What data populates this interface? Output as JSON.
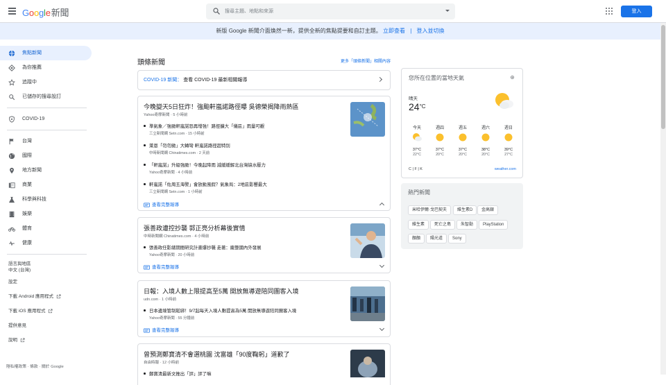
{
  "header": {
    "logo_parts": [
      "G",
      "o",
      "o",
      "g",
      "l",
      "e"
    ],
    "logo_suffix": "新聞",
    "search_placeholder": "搜尋主題、地點和來源",
    "signin_label": "登入"
  },
  "banner": {
    "text": "新版 Google 新聞介面煥然一新，提供全新的焦點提要和自訂主題。",
    "try_link": "立即查看",
    "separator": "|",
    "login_link": "登入並切換"
  },
  "sidebar": {
    "items": [
      {
        "label": "焦點新聞",
        "icon": "globe-icon",
        "active": true
      },
      {
        "label": "為你推薦",
        "icon": "diamond-icon"
      },
      {
        "label": "追蹤中",
        "icon": "star-icon"
      },
      {
        "label": "已儲存的搜尋設訂",
        "icon": "search-icon"
      }
    ],
    "covid": {
      "label": "COVID-19",
      "icon": "shield-icon"
    },
    "sections": [
      {
        "label": "台灣",
        "icon": "flag-icon"
      },
      {
        "label": "國際",
        "icon": "globe-icon"
      },
      {
        "label": "地方新聞",
        "icon": "pin-icon"
      },
      {
        "label": "商業",
        "icon": "building-icon"
      },
      {
        "label": "科學與科技",
        "icon": "flask-icon"
      },
      {
        "label": "娛樂",
        "icon": "film-icon"
      },
      {
        "label": "體育",
        "icon": "bike-icon"
      },
      {
        "label": "健康",
        "icon": "health-icon"
      }
    ],
    "lang_title": "語言與地區",
    "lang_value": "中文 (台灣)",
    "settings": "設定",
    "android": "下載 Android 應用程式",
    "ios": "下載 iOS 應用程式",
    "feedback": "提供意見",
    "help": "說明"
  },
  "footer": "隱私權政策 · 條款 · 關於 Google",
  "main": {
    "title": "頭條新聞",
    "more": "更多「頭條新聞」相關內容",
    "covid_label": "COVID-19 新聞：",
    "covid_text": "查看 COVID-19 最新相關報導",
    "full_coverage": "查看完整報導",
    "stories": [
      {
        "title": "今晚變天5日狂炸！強颱軒嵐諾路徑曝 吳德榮揭降雨熱區",
        "source": "Yahoo奇摩新聞 · 5 小時前",
        "subs": [
          {
            "title": "準氣象／強颱軒嵐諾恐再增強！路徑擴大「儀區」雨量可觀",
            "source": "三立新聞網 Setn.com · 15 小時前"
          },
          {
            "title": "萊恩「勿勿颱」大轉彎 軒嵐諾路徑超特別",
            "source": "中時新聞網 Chinatimes.com · 2 天前"
          },
          {
            "title": "「軒嵐諾」升級強颱！今晚起降雨 減緩緩解北台灣缺水壓力",
            "source": "Yahoo奇摩新聞 · 4 小時前"
          },
          {
            "title": "軒嵐諾「佐周五海警」會放颱風假？氣象局：2地區影響最大",
            "source": "三立新聞網 Setn.com · 1 小時前"
          }
        ]
      },
      {
        "title": "張善政遭控抄襲 郭正亮分析幕後實情",
        "source": "中時新聞網 Chinatimes.com · 4 小時前",
        "subs": [
          {
            "title": "張善政任影總期間研究計畫爆抄襲 走著：龐整國內外發展",
            "source": "Yahoo奇摩新聞 · 20 小時前"
          }
        ]
      },
      {
        "title": "日報：入境人數上限提高至5萬 開放無導遊陪同團客入境",
        "source": "udn.com · 1 小時前",
        "subs": [
          {
            "title": "日本邊境管制鬆綁！9/7起每天入境人數提高為5萬 開放無導遊陪同團客入境",
            "source": "Yahoo奇摩新聞 · 55 分鐘前"
          }
        ]
      },
      {
        "title": "曾預測鄭寶清不會選桃園 沈富雄「90度鞠躬」道歉了",
        "source": "自由時報 · 12 小時前",
        "subs": [
          {
            "title": "鄭寶清最新文推出「評」評了嘛",
            "source": ""
          }
        ]
      }
    ]
  },
  "weather": {
    "title": "您所在位置的當地天氣",
    "condition": "晴天",
    "temp": "24",
    "unit": "°C",
    "forecast": [
      {
        "day": "今天",
        "hi": "37°C",
        "lo": "22°C",
        "icon": "partly-cloudy-icon"
      },
      {
        "day": "週四",
        "hi": "37°C",
        "lo": "20°C",
        "icon": "sunny-icon"
      },
      {
        "day": "週五",
        "hi": "37°C",
        "lo": "20°C",
        "icon": "sunny-icon"
      },
      {
        "day": "週六",
        "hi": "38°C",
        "lo": "20°C",
        "icon": "sunny-icon"
      },
      {
        "day": "週日",
        "hi": "39°C",
        "lo": "27°C",
        "icon": "sunny-icon"
      }
    ],
    "units": "C | F | K",
    "provider": "weather.com"
  },
  "hot": {
    "title": "熱門新聞",
    "chips": [
      "米哈伊爾·戈巴契夫",
      "維生素D",
      "金高銀",
      "維生素",
      "死亡之島",
      "朱智勛",
      "PlayStation",
      "顏顏",
      "陽光道",
      "Sony"
    ]
  },
  "colors": {
    "accent": "#1a73e8",
    "active_bg": "#e8f0fe"
  }
}
